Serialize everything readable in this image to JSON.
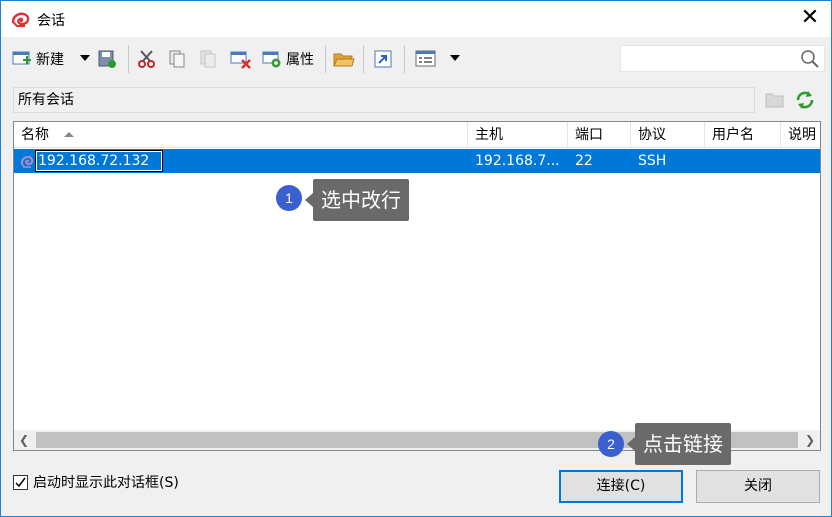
{
  "window": {
    "title": "会话"
  },
  "toolbar": {
    "new_label": "新建",
    "properties_label": "属性"
  },
  "search": {
    "placeholder": "",
    "value": ""
  },
  "folder": {
    "path": "所有会话"
  },
  "list": {
    "columns": [
      "名称",
      "主机",
      "端口",
      "协议",
      "用户名",
      "说明"
    ],
    "sort_column": "名称",
    "rows": [
      {
        "name": "192.168.72.132",
        "host": "192.168.7...",
        "port": "22",
        "protocol": "SSH",
        "user": "",
        "note": "",
        "selected": true,
        "editing": true
      }
    ]
  },
  "footer": {
    "show_on_startup_label": "启动时显示此对话框(S)",
    "show_on_startup_checked": true,
    "connect_label": "连接(C)",
    "close_label": "关闭"
  },
  "annotations": [
    {
      "number": "1",
      "text": "选中改行"
    },
    {
      "number": "2",
      "text": "点击链接"
    }
  ],
  "colors": {
    "selection": "#0078d7",
    "accent": "#1883d7",
    "badge": "#3b5fcf",
    "callout": "#6a6a6a"
  }
}
